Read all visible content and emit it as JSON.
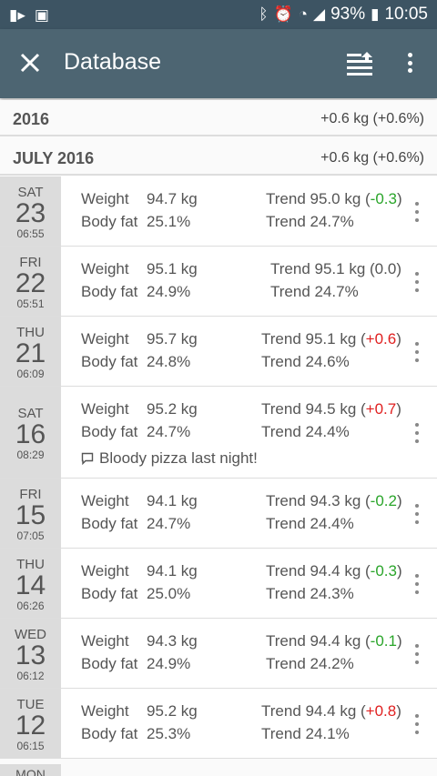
{
  "status": {
    "battery": "93%",
    "time": "10:05"
  },
  "appbar": {
    "title": "Database"
  },
  "year": {
    "label": "2016",
    "change": "+0.6 kg (+0.6%)"
  },
  "month": {
    "label": "JULY 2016",
    "change": "+0.6 kg (+0.6%)"
  },
  "labels": {
    "weight": "Weight",
    "bodyfat": "Body fat",
    "trend": "Trend"
  },
  "rows": [
    {
      "dow": "SAT",
      "day": "23",
      "time": "06:55",
      "weight": "94.7 kg",
      "fat": "25.1%",
      "trend_w": "95.0 kg (",
      "trend_d": "-0.3",
      "trend_sign": "neg",
      "trend_f": "24.7%"
    },
    {
      "dow": "FRI",
      "day": "22",
      "time": "05:51",
      "weight": "95.1 kg",
      "fat": "24.9%",
      "trend_w": "95.1 kg (",
      "trend_d": "0.0",
      "trend_sign": "zero",
      "trend_f": "24.7%"
    },
    {
      "dow": "THU",
      "day": "21",
      "time": "06:09",
      "weight": "95.7 kg",
      "fat": "24.8%",
      "trend_w": "95.1 kg (",
      "trend_d": "+0.6",
      "trend_sign": "pos",
      "trend_f": "24.6%"
    },
    {
      "dow": "SAT",
      "day": "16",
      "time": "08:29",
      "weight": "95.2 kg",
      "fat": "24.7%",
      "trend_w": "94.5 kg (",
      "trend_d": "+0.7",
      "trend_sign": "pos",
      "trend_f": "24.4%",
      "note": "Bloody pizza last night!"
    },
    {
      "dow": "FRI",
      "day": "15",
      "time": "07:05",
      "weight": "94.1 kg",
      "fat": "24.7%",
      "trend_w": "94.3 kg (",
      "trend_d": "-0.2",
      "trend_sign": "neg",
      "trend_f": "24.4%"
    },
    {
      "dow": "THU",
      "day": "14",
      "time": "06:26",
      "weight": "94.1 kg",
      "fat": "25.0%",
      "trend_w": "94.4 kg (",
      "trend_d": "-0.3",
      "trend_sign": "neg",
      "trend_f": "24.3%"
    },
    {
      "dow": "WED",
      "day": "13",
      "time": "06:12",
      "weight": "94.3 kg",
      "fat": "24.9%",
      "trend_w": "94.4 kg (",
      "trend_d": "-0.1",
      "trend_sign": "neg",
      "trend_f": "24.2%"
    },
    {
      "dow": "TUE",
      "day": "12",
      "time": "06:15",
      "weight": "95.2 kg",
      "fat": "25.3%",
      "trend_w": "94.4 kg (",
      "trend_d": "+0.8",
      "trend_sign": "pos",
      "trend_f": "24.1%"
    }
  ],
  "partial_row": {
    "dow": "MON"
  }
}
